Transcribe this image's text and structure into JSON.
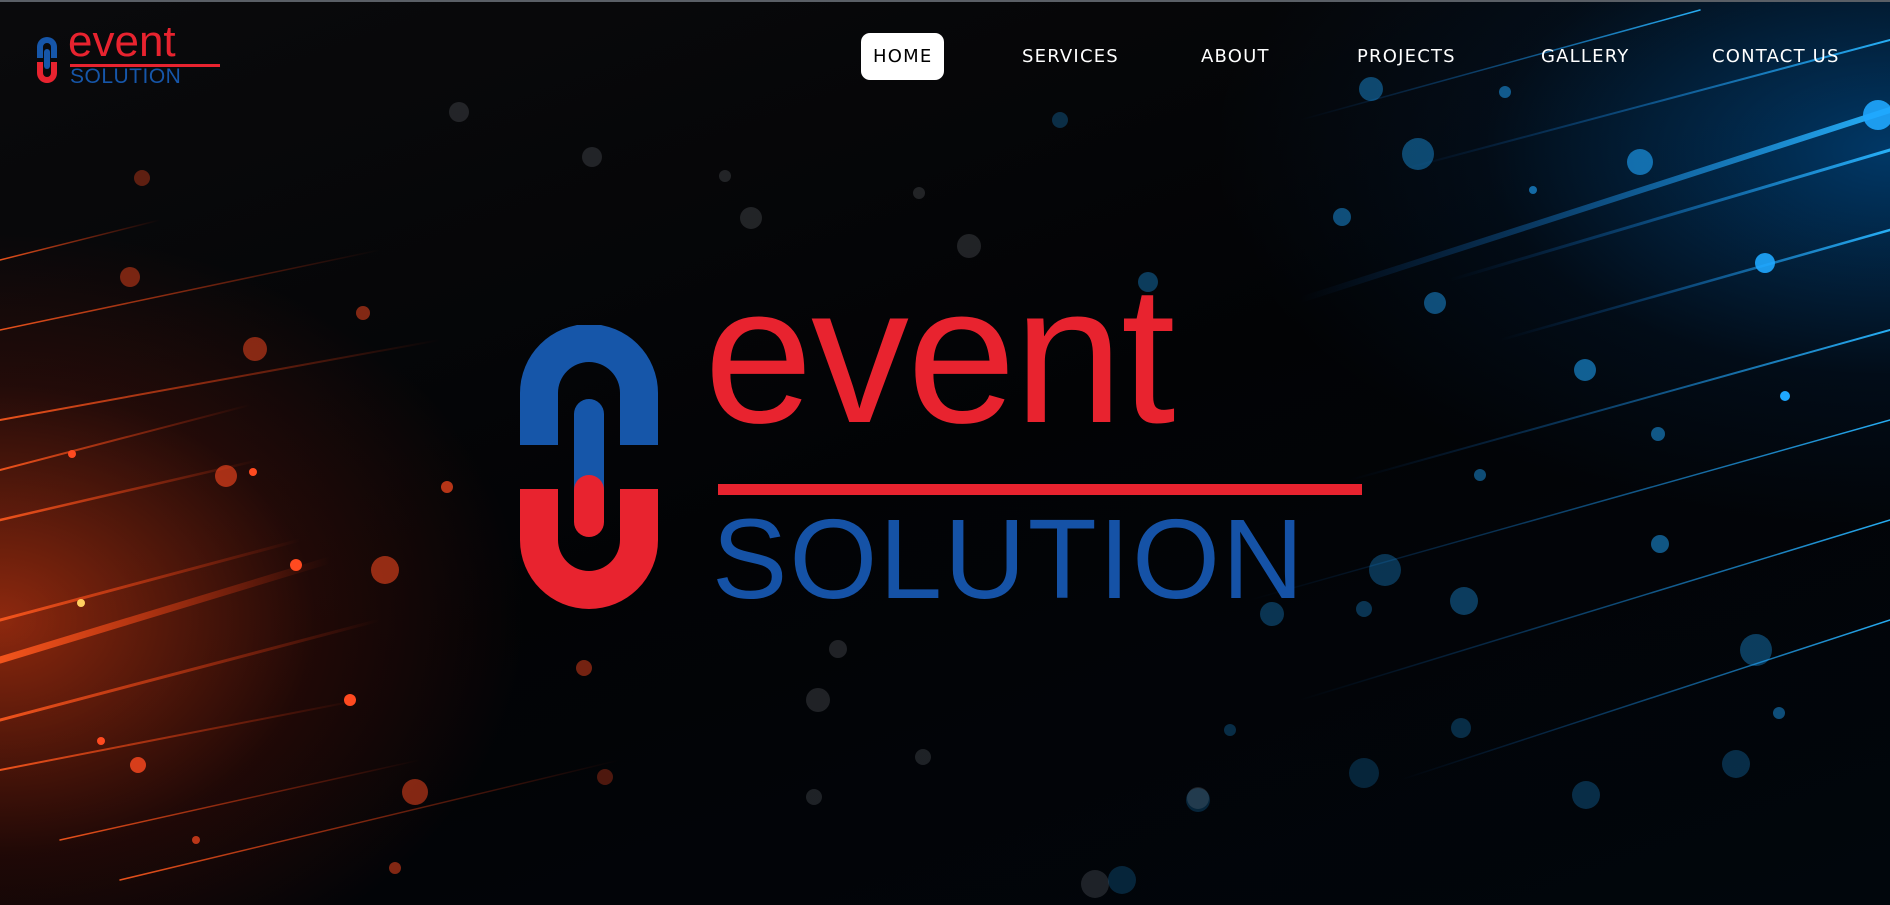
{
  "brand": {
    "word_primary": "event",
    "word_secondary": "SOLUTION",
    "colors": {
      "red": "#e8232f",
      "blue": "#1656a9"
    }
  },
  "nav": {
    "items": [
      {
        "label": "HOME",
        "active": true
      },
      {
        "label": "SERVICES",
        "active": false
      },
      {
        "label": "ABOUT",
        "active": false
      },
      {
        "label": "PROJECTS",
        "active": false
      },
      {
        "label": "GALLERY",
        "active": false
      },
      {
        "label": "CONTACT US",
        "active": false
      }
    ]
  },
  "hero": {
    "background": "dark with red-orange light streaks at left and blue light streaks at right",
    "colors": {
      "left_glow": "#ff4a1a",
      "right_glow": "#1aa0ff",
      "base": "#020406"
    }
  }
}
